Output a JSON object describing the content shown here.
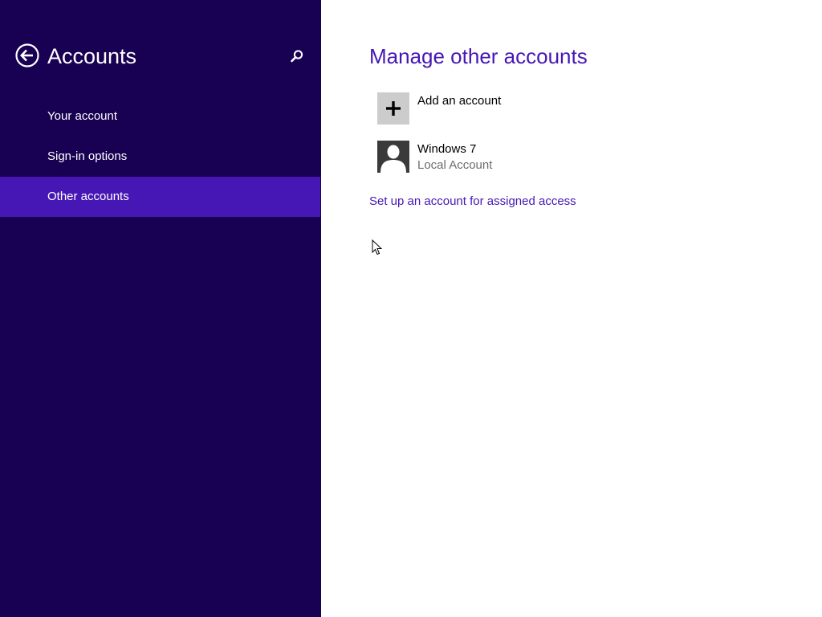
{
  "nav_pane": {
    "title": "Accounts",
    "items": [
      {
        "label": "Your account",
        "selected": false
      },
      {
        "label": "Sign-in options",
        "selected": false
      },
      {
        "label": "Other accounts",
        "selected": true
      }
    ],
    "back_icon": "back-arrow-circle-icon",
    "search_icon": "search-icon",
    "background_color": "#180052",
    "selected_color": "#4617b4"
  },
  "main": {
    "title": "Manage other accounts",
    "add_account": {
      "label": "Add an account",
      "icon": "plus-icon"
    },
    "accounts": [
      {
        "name": "Windows 7",
        "type": "Local Account",
        "icon": "user-avatar-icon"
      }
    ],
    "assigned_access_link": "Set up an account for assigned access",
    "accent_color": "#4617b4"
  }
}
